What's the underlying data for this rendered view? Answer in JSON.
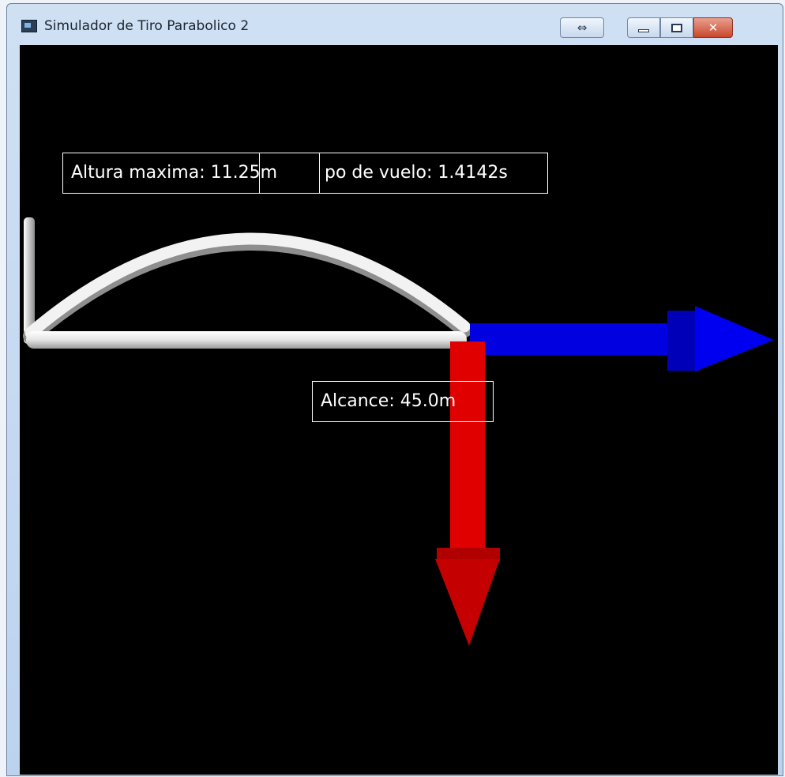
{
  "window": {
    "title": "Simulador de Tiro Parabolico 2",
    "buttons": {
      "resize_glyph": "⇔",
      "close_glyph": "✕"
    }
  },
  "scene": {
    "labels": {
      "altura": "Altura maxima: 11.25m",
      "tiempo": "po de vuelo: 1.4142s",
      "alcance": "Alcance: 45.0m"
    },
    "colors": {
      "background": "#000000",
      "trajectory": "#ececec",
      "x_arrow": "#0000e6",
      "y_arrow": "#e00000"
    }
  }
}
